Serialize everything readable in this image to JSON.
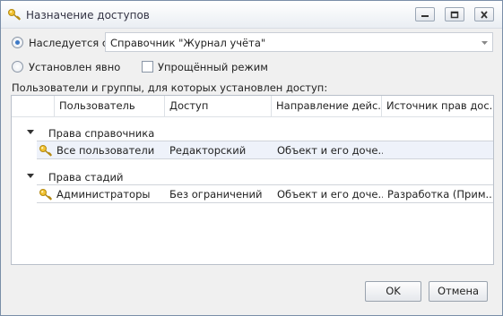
{
  "window": {
    "title": "Назначение доступов",
    "icon": "key-icon",
    "controls": [
      "minimize-icon",
      "maximize-icon",
      "close-icon"
    ]
  },
  "inherit": {
    "label": "Наследуется с:",
    "checked": true,
    "source_value": "Справочник \"Журнал учёта\""
  },
  "explicit": {
    "label": "Установлен явно",
    "checked": false
  },
  "simplified_mode": {
    "label": "Упрощённый режим",
    "checked": false
  },
  "grid_caption": "Пользователи и группы, для которых установлен доступ:",
  "grid": {
    "columns": [
      "Пользователь",
      "Доступ",
      "Направление дейс...",
      "Источник прав дос..."
    ],
    "groups": [
      {
        "label": "Права справочника",
        "rows": [
          {
            "user": "Все пользователи",
            "access": "Редакторский",
            "direction": "Объект и его доче...",
            "source": "",
            "selected": true
          }
        ]
      },
      {
        "label": "Права стадий",
        "rows": [
          {
            "user": "Администраторы",
            "access": "Без ограничений",
            "direction": "Объект и его доче...",
            "source": "Разработка (Прим...",
            "selected": false
          }
        ]
      }
    ]
  },
  "buttons": {
    "ok": "OK",
    "cancel": "Отмена"
  }
}
